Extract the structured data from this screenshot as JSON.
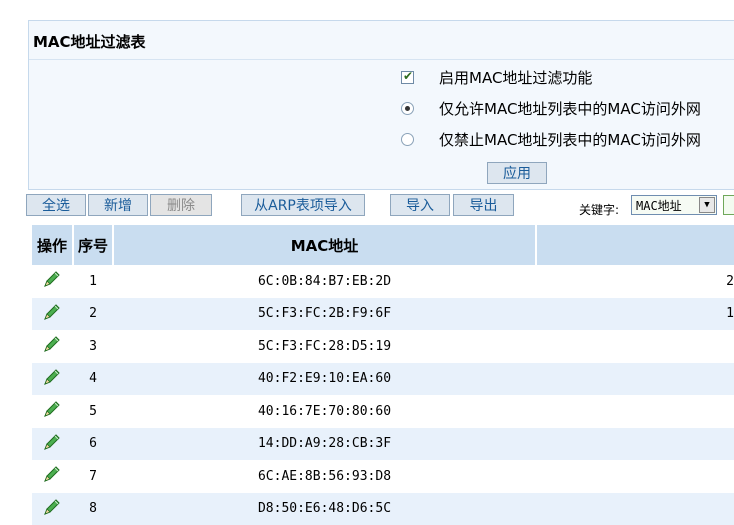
{
  "filter_panel": {
    "title": "MAC地址过滤表",
    "enable_label": "启用MAC地址过滤功能",
    "enable_checked": true,
    "allow_label": "仅允许MAC地址列表中的MAC访问外网",
    "deny_label": "仅禁止MAC地址列表中的MAC访问外网",
    "mode_selected": "allow",
    "apply_label": "应用"
  },
  "toolbar": {
    "select_all": "全选",
    "add": "新增",
    "delete": "删除",
    "import_arp": "从ARP表项导入",
    "import": "导入",
    "export": "导出",
    "keyword_label": "关键字:",
    "keyword_select": "MAC地址"
  },
  "table": {
    "headers": {
      "op": "操作",
      "index": "序号",
      "mac": "MAC地址"
    },
    "rows": [
      {
        "index": "1",
        "mac": "6C:0B:84:B7:EB:2D",
        "extra": "2"
      },
      {
        "index": "2",
        "mac": "5C:F3:FC:2B:F9:6F",
        "extra": "1"
      },
      {
        "index": "3",
        "mac": "5C:F3:FC:28:D5:19",
        "extra": ""
      },
      {
        "index": "4",
        "mac": "40:F2:E9:10:EA:60",
        "extra": ""
      },
      {
        "index": "5",
        "mac": "40:16:7E:70:80:60",
        "extra": ""
      },
      {
        "index": "6",
        "mac": "14:DD:A9:28:CB:3F",
        "extra": ""
      },
      {
        "index": "7",
        "mac": "6C:AE:8B:56:93:D8",
        "extra": ""
      },
      {
        "index": "8",
        "mac": "D8:50:E6:48:D6:5C",
        "extra": ""
      }
    ]
  },
  "colors": {
    "header_bg": "#c9ddf0",
    "row_alt": "#e8f1fb",
    "panel_bg": "#f3f8fd",
    "link": "#1a5c9a"
  }
}
